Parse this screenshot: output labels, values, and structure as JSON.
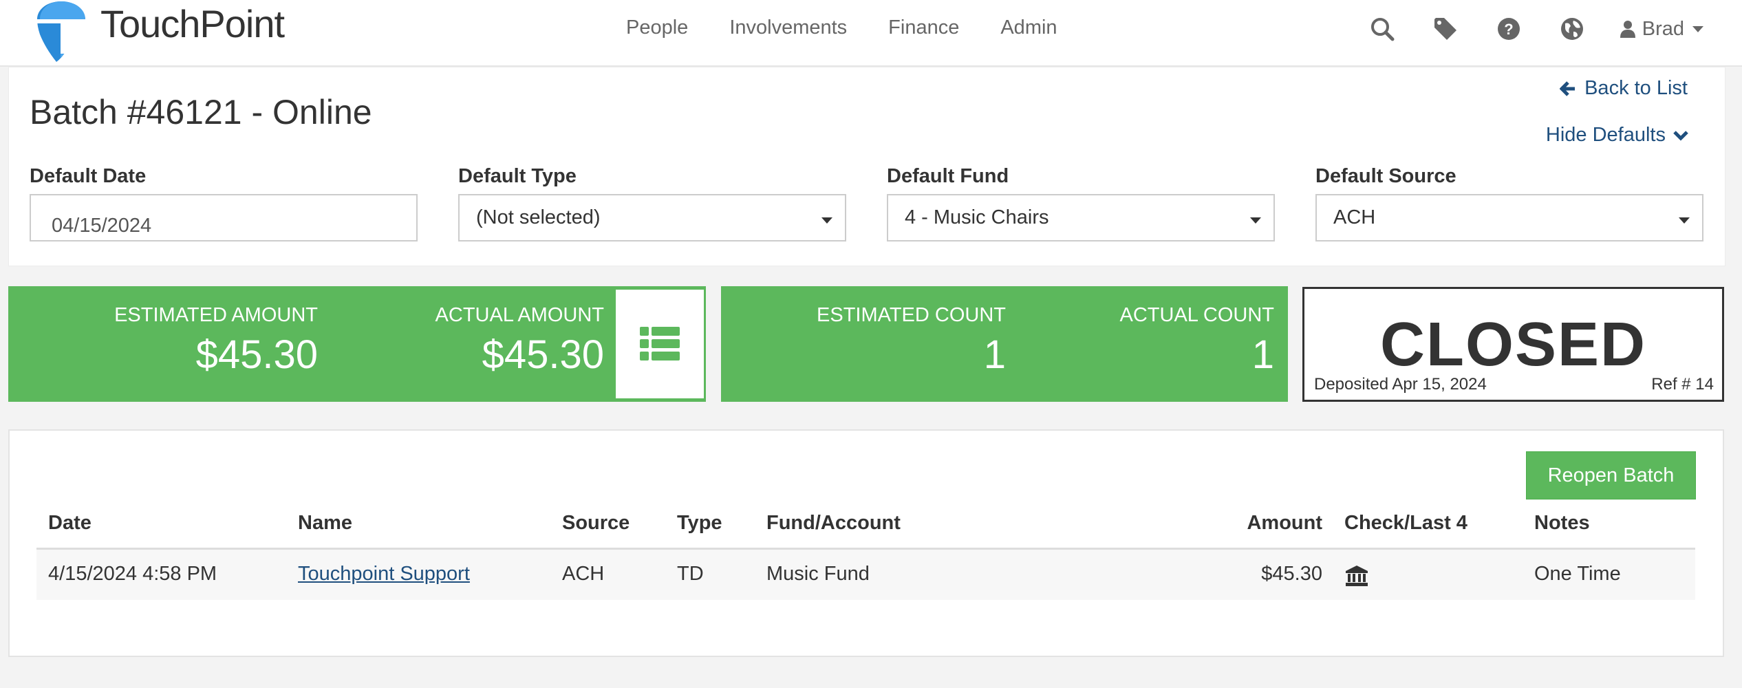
{
  "nav": {
    "brand": "TouchPoint",
    "links": [
      "People",
      "Involvements",
      "Finance",
      "Admin"
    ],
    "icons": [
      "search-icon",
      "tag-icon",
      "help-icon",
      "globe-icon"
    ],
    "user": "Brad"
  },
  "header": {
    "title": "Batch #46121 - Online",
    "back_label": "Back to List",
    "hide_defaults_label": "Hide Defaults",
    "fields": {
      "date": {
        "label": "Default Date",
        "value": "04/15/2024"
      },
      "type": {
        "label": "Default Type",
        "value": "(Not selected)"
      },
      "fund": {
        "label": "Default Fund",
        "value": "4 - Music Chairs"
      },
      "source": {
        "label": "Default Source",
        "value": "ACH"
      }
    }
  },
  "stats": {
    "estimated_amount_label": "ESTIMATED AMOUNT",
    "estimated_amount": "$45.30",
    "actual_amount_label": "ACTUAL AMOUNT",
    "actual_amount": "$45.30",
    "estimated_count_label": "ESTIMATED COUNT",
    "estimated_count": "1",
    "actual_count_label": "ACTUAL COUNT",
    "actual_count": "1",
    "status": "CLOSED",
    "deposited": "Deposited Apr 15, 2024",
    "ref": "Ref # 14"
  },
  "table": {
    "reopen_label": "Reopen Batch",
    "headers": {
      "date": "Date",
      "name": "Name",
      "source": "Source",
      "type": "Type",
      "fund": "Fund/Account",
      "amount": "Amount",
      "check": "Check/Last 4",
      "notes": "Notes"
    },
    "rows": [
      {
        "date": "4/15/2024 4:58 PM",
        "name": "Touchpoint Support",
        "source": "ACH",
        "type": "TD",
        "fund": "Music Fund",
        "amount": "$45.30",
        "check_icon": "bank-icon",
        "notes": "One Time"
      }
    ]
  },
  "colors": {
    "accent_green": "#5cb85c",
    "link_blue": "#1f4f7e",
    "logo_blue": "#2a8ad8"
  }
}
